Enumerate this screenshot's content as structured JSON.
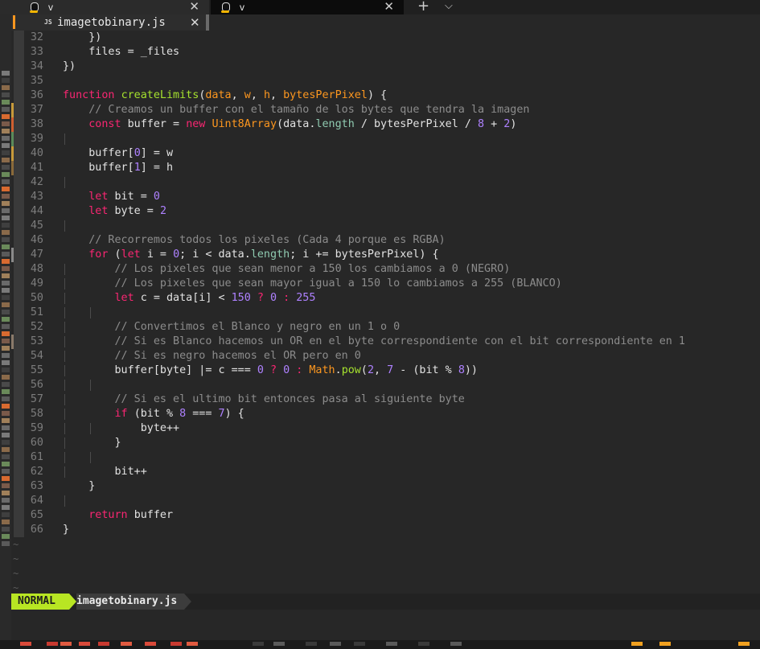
{
  "terminal": {
    "tabs": [
      {
        "title": "v",
        "active": false
      },
      {
        "title": "v",
        "active": true
      }
    ],
    "new_tab": "+",
    "dropdown": "⌵",
    "close": "✕"
  },
  "vim": {
    "buffer_tab": {
      "icon": "JS",
      "name": "imagetobinary.js",
      "close": "✕"
    },
    "statusline": {
      "mode": "NORMAL",
      "file": "imagetobinary.js"
    },
    "tilde": "~"
  },
  "colors": {
    "mode_bg": "#b8e623",
    "keyword": "#f92672",
    "function": "#a6e22e",
    "param": "#fd971f",
    "number": "#ae81ff",
    "comment": "#8c8c8c",
    "type": "#66d9ef"
  },
  "lines": [
    {
      "n": "32",
      "i": 1,
      "t": [
        [
          "p",
          "})"
        ]
      ]
    },
    {
      "n": "33",
      "i": 1,
      "t": [
        [
          "p",
          "files = _files"
        ]
      ]
    },
    {
      "n": "34",
      "i": 0,
      "t": [
        [
          "p",
          "})"
        ]
      ]
    },
    {
      "n": "35",
      "i": 0,
      "t": []
    },
    {
      "n": "36",
      "i": 0,
      "t": [
        [
          "kw",
          "function "
        ],
        [
          "fn",
          "createLimits"
        ],
        [
          "p",
          "("
        ],
        [
          "par",
          "data"
        ],
        [
          "p",
          ", "
        ],
        [
          "par",
          "w"
        ],
        [
          "p",
          ", "
        ],
        [
          "par",
          "h"
        ],
        [
          "p",
          ", "
        ],
        [
          "par",
          "bytesPerPixel"
        ],
        [
          "p",
          ") {"
        ]
      ]
    },
    {
      "n": "37",
      "i": 1,
      "t": [
        [
          "cm",
          "// Creamos un buffer con el tamaño de los bytes que tendra la imagen"
        ]
      ]
    },
    {
      "n": "38",
      "i": 1,
      "t": [
        [
          "kw",
          "const "
        ],
        [
          "p",
          "buffer = "
        ],
        [
          "kw",
          "new "
        ],
        [
          "par",
          "Uint8Array"
        ],
        [
          "p",
          "(data."
        ],
        [
          "prop",
          "length"
        ],
        [
          "p",
          " / bytesPerPixel / "
        ],
        [
          "nm",
          "8"
        ],
        [
          "p",
          " + "
        ],
        [
          "nm",
          "2"
        ],
        [
          "p",
          ")"
        ]
      ]
    },
    {
      "n": "39",
      "i": 1,
      "g": true,
      "t": []
    },
    {
      "n": "40",
      "i": 1,
      "t": [
        [
          "p",
          "buffer["
        ],
        [
          "nm",
          "0"
        ],
        [
          "p",
          "] = w"
        ]
      ]
    },
    {
      "n": "41",
      "i": 1,
      "t": [
        [
          "p",
          "buffer["
        ],
        [
          "nm",
          "1"
        ],
        [
          "p",
          "] = h"
        ]
      ]
    },
    {
      "n": "42",
      "i": 1,
      "g": true,
      "t": []
    },
    {
      "n": "43",
      "i": 1,
      "t": [
        [
          "kw",
          "let "
        ],
        [
          "p",
          "bit = "
        ],
        [
          "nm",
          "0"
        ]
      ]
    },
    {
      "n": "44",
      "i": 1,
      "t": [
        [
          "kw",
          "let "
        ],
        [
          "p",
          "byte = "
        ],
        [
          "nm",
          "2"
        ]
      ]
    },
    {
      "n": "45",
      "i": 1,
      "g": true,
      "t": []
    },
    {
      "n": "46",
      "i": 1,
      "t": [
        [
          "cm",
          "// Recorremos todos los pixeles (Cada 4 porque es RGBA)"
        ]
      ]
    },
    {
      "n": "47",
      "i": 1,
      "t": [
        [
          "kw",
          "for "
        ],
        [
          "p",
          "("
        ],
        [
          "kw",
          "let "
        ],
        [
          "p",
          "i = "
        ],
        [
          "nm",
          "0"
        ],
        [
          "p",
          "; i < data."
        ],
        [
          "prop",
          "length"
        ],
        [
          "p",
          "; i += bytesPerPixel) {"
        ]
      ]
    },
    {
      "n": "48",
      "i": 2,
      "t": [
        [
          "cm",
          "// Los pixeles que sean menor a 150 los cambiamos a 0 (NEGRO)"
        ]
      ]
    },
    {
      "n": "49",
      "i": 2,
      "t": [
        [
          "cm",
          "// Los pixeles que sean mayor igual a 150 lo cambiamos a 255 (BLANCO)"
        ]
      ]
    },
    {
      "n": "50",
      "i": 2,
      "t": [
        [
          "kw",
          "let "
        ],
        [
          "p",
          "c = data[i] < "
        ],
        [
          "nm",
          "150"
        ],
        [
          "kw",
          " ? "
        ],
        [
          "nm",
          "0"
        ],
        [
          "kw",
          " : "
        ],
        [
          "nm",
          "255"
        ]
      ]
    },
    {
      "n": "51",
      "i": 2,
      "g": true,
      "t": []
    },
    {
      "n": "52",
      "i": 2,
      "t": [
        [
          "cm",
          "// Convertimos el Blanco y negro en un 1 o 0"
        ]
      ]
    },
    {
      "n": "53",
      "i": 2,
      "t": [
        [
          "cm",
          "// Si es Blanco hacemos un OR en el byte correspondiente con el bit correspondiente en 1"
        ]
      ]
    },
    {
      "n": "54",
      "i": 2,
      "t": [
        [
          "cm",
          "// Si es negro hacemos el OR pero en 0"
        ]
      ]
    },
    {
      "n": "55",
      "i": 2,
      "t": [
        [
          "p",
          "buffer[byte] |= c === "
        ],
        [
          "nm",
          "0"
        ],
        [
          "kw",
          " ? "
        ],
        [
          "nm",
          "0"
        ],
        [
          "kw",
          " : "
        ],
        [
          "par",
          "Math"
        ],
        [
          "p",
          "."
        ],
        [
          "fn",
          "pow"
        ],
        [
          "p",
          "("
        ],
        [
          "nm",
          "2"
        ],
        [
          "p",
          ", "
        ],
        [
          "nm",
          "7"
        ],
        [
          "p",
          " - (bit % "
        ],
        [
          "nm",
          "8"
        ],
        [
          "p",
          "))"
        ]
      ]
    },
    {
      "n": "56",
      "i": 2,
      "g": true,
      "t": []
    },
    {
      "n": "57",
      "i": 2,
      "t": [
        [
          "cm",
          "// Si es el ultimo bit entonces pasa al siguiente byte"
        ]
      ]
    },
    {
      "n": "58",
      "i": 2,
      "t": [
        [
          "kw",
          "if "
        ],
        [
          "p",
          "(bit % "
        ],
        [
          "nm",
          "8"
        ],
        [
          "p",
          " === "
        ],
        [
          "nm",
          "7"
        ],
        [
          "p",
          ") {"
        ]
      ]
    },
    {
      "n": "59",
      "i": 3,
      "t": [
        [
          "p",
          "byte++"
        ]
      ]
    },
    {
      "n": "60",
      "i": 2,
      "t": [
        [
          "p",
          "}"
        ]
      ]
    },
    {
      "n": "61",
      "i": 2,
      "g": true,
      "t": []
    },
    {
      "n": "62",
      "i": 2,
      "t": [
        [
          "p",
          "bit++"
        ]
      ]
    },
    {
      "n": "63",
      "i": 1,
      "t": [
        [
          "p",
          "}"
        ]
      ]
    },
    {
      "n": "64",
      "i": 1,
      "g": true,
      "t": []
    },
    {
      "n": "65",
      "i": 1,
      "t": [
        [
          "kw",
          "return "
        ],
        [
          "p",
          "buffer"
        ]
      ]
    },
    {
      "n": "66",
      "i": 0,
      "t": [
        [
          "p",
          "}"
        ]
      ]
    }
  ]
}
